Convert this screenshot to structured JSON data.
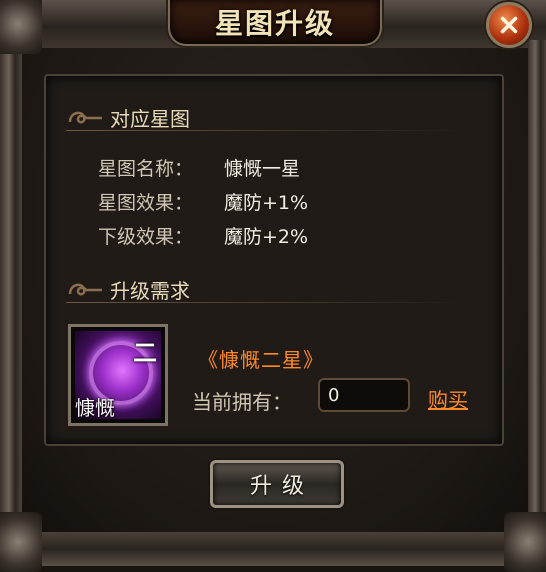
{
  "window": {
    "title": "星图升级",
    "close_icon": "close-icon"
  },
  "current_chart": {
    "heading": "对应星图",
    "rows": [
      {
        "label": "星图名称：",
        "value": "慷慨一星"
      },
      {
        "label": "星图效果：",
        "value": "魔防+1%"
      },
      {
        "label": "下级效果：",
        "value": "魔防+2%"
      }
    ]
  },
  "requirements": {
    "heading": "升级需求",
    "item": {
      "icon": "star-chart-item-icon",
      "grade": "二",
      "name": "慷慨"
    },
    "required_name": "《慷慨二星》",
    "owned_label": "当前拥有：",
    "owned_value": "0",
    "buy_label": "购买"
  },
  "actions": {
    "upgrade_label": "升级"
  },
  "colors": {
    "accent_orange": "#ff8a2a",
    "title_text": "#f3e3b8",
    "value_text": "#f1ede2"
  }
}
